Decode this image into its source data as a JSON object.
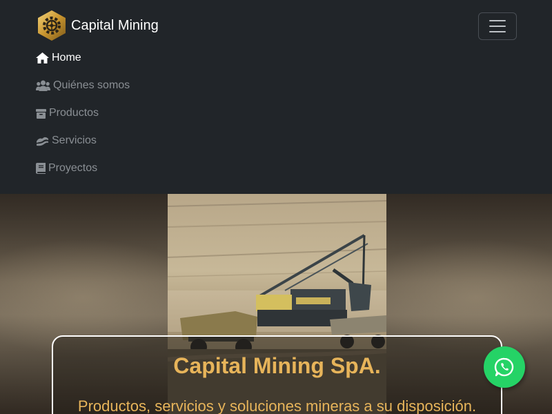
{
  "brand": {
    "name": "Capital Mining",
    "logo_icon": "gear-hexagon-logo"
  },
  "navbar": {
    "toggler_icon": "hamburger-icon",
    "items": [
      {
        "label": "Home",
        "icon": "home-icon",
        "active": true
      },
      {
        "label": "Quiénes somos",
        "icon": "users-icon",
        "active": false
      },
      {
        "label": "Productos",
        "icon": "box-icon",
        "active": false
      },
      {
        "label": "Servicios",
        "icon": "handshake-icon",
        "active": false
      },
      {
        "label": "Proyectos",
        "icon": "book-icon",
        "active": false
      }
    ]
  },
  "hero": {
    "title": "Capital Mining SpA.",
    "subtitle": "Productos, servicios y soluciones mineras a su disposición."
  },
  "whatsapp": {
    "icon": "whatsapp-icon"
  },
  "colors": {
    "navbar_bg": "#212529",
    "accent_gold": "#e7b45a",
    "nav_inactive": "#8a8f94",
    "whatsapp_green": "#25d366"
  }
}
